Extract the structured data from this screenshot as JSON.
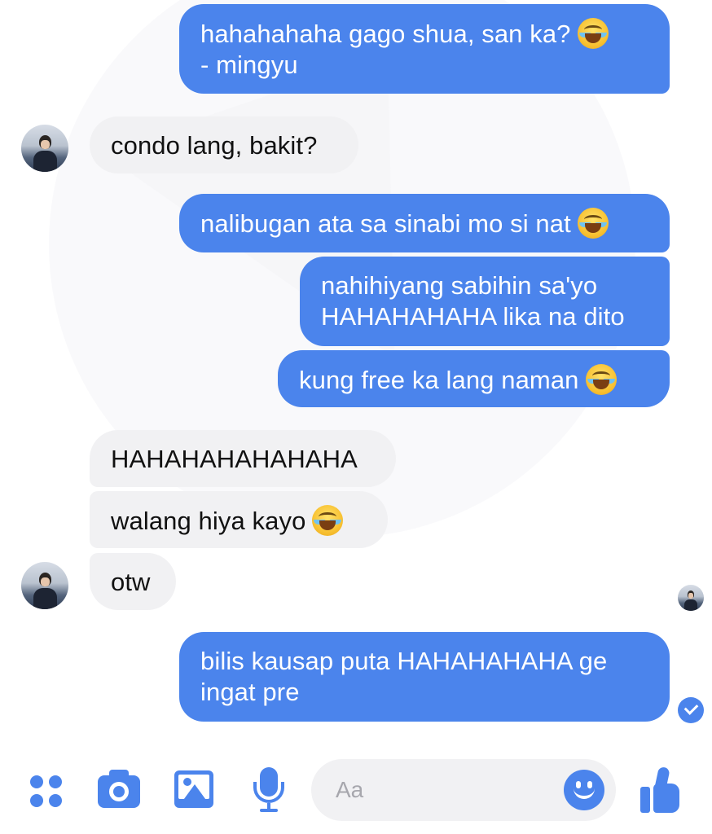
{
  "colors": {
    "outgoing_bubble": "#4b84ec",
    "incoming_bubble": "#f1f1f3",
    "accent": "#4b84ec"
  },
  "messages": [
    {
      "direction": "outgoing",
      "lines": [
        "hahahahaha gago shua, san ka?",
        "- mingyu"
      ],
      "emoji": "tears-of-joy"
    },
    {
      "direction": "incoming",
      "text": "condo lang, bakit?"
    },
    {
      "direction": "outgoing",
      "text": "nalibugan ata sa sinabi mo si nat",
      "emoji": "tears-of-joy"
    },
    {
      "direction": "outgoing",
      "lines": [
        "nahihiyang sabihin sa'yo",
        "HAHAHAHAHA lika na dito"
      ]
    },
    {
      "direction": "outgoing",
      "text": "kung free ka lang naman",
      "emoji": "tears-of-joy"
    },
    {
      "direction": "incoming",
      "text": "HAHAHAHAHAHAHA"
    },
    {
      "direction": "incoming",
      "text": "walang hiya kayo",
      "emoji": "tears-of-joy"
    },
    {
      "direction": "incoming",
      "text": "otw"
    },
    {
      "direction": "outgoing",
      "lines": [
        "bilis kausap puta HAHAHAHAHA ge",
        "ingat pre"
      ]
    }
  ],
  "composer": {
    "placeholder": "Aa",
    "icons": [
      "more-apps-icon",
      "camera-icon",
      "photo-icon",
      "microphone-icon",
      "emoji-icon",
      "like-thumb-icon"
    ]
  },
  "status": {
    "read_receipt": "avatar",
    "sent_indicator": "check-circle-icon"
  }
}
